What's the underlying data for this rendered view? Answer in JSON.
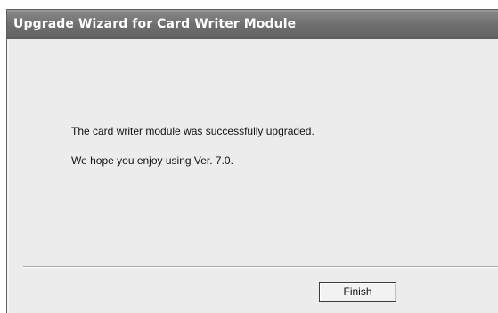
{
  "window": {
    "title": "Upgrade Wizard for Card Writer Module"
  },
  "content": {
    "message_line_1": "The card writer module was successfully upgraded.",
    "message_line_2": "We hope you enjoy using Ver. 7.0."
  },
  "buttons": {
    "finish_label": "Finish"
  }
}
